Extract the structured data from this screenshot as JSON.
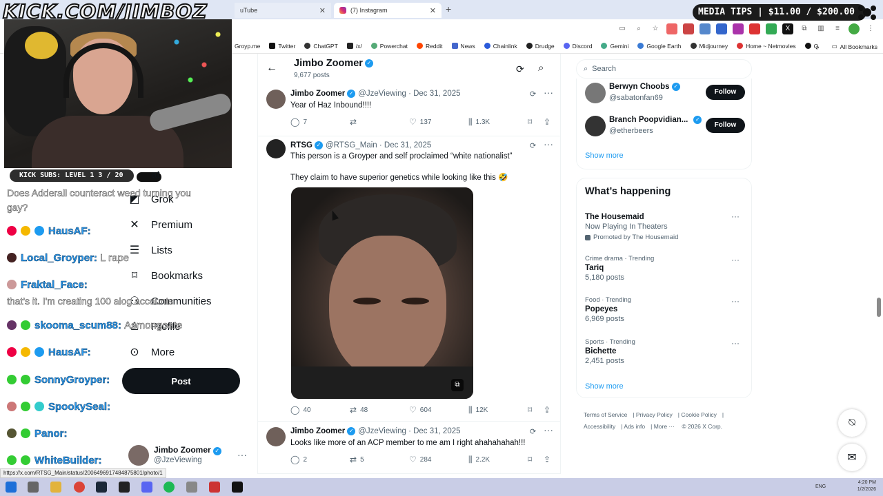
{
  "browser": {
    "tabs": [
      {
        "title": "uTube",
        "icon": "youtube-icon"
      },
      {
        "title": "(7) Instagram",
        "icon": "instagram-icon"
      }
    ],
    "bookmarks": [
      "Groyp.me",
      "Twitter",
      "ChatGPT",
      "/x/",
      "Powerchat",
      "Reddit",
      "News",
      "Chainlink",
      "Drudge",
      "Discord",
      "Gemini",
      "Google Earth",
      "Midjourney",
      "Home ~ Netmovies",
      "Q"
    ],
    "all_bookmarks": "All Bookmarks",
    "status_url": "https://x.com/RTSG_Main/status/2006496917484875801/photo/1"
  },
  "overlay": {
    "stream_title": "KICK.COM/JIMBOZ",
    "media_tips": "MEDIA TIPS | $11.00 / $200.00",
    "kick_subs": "KICK SUBS: LEVEL 1 3 / 20",
    "chat": [
      {
        "text": "Does Adderall counteract weed turning you gay?"
      },
      {
        "user": "HausAF:",
        "msg": ""
      },
      {
        "user": "Local_Groyper:",
        "msg": "L rape"
      },
      {
        "user": "Fraktal_Face:",
        "msg": ""
      },
      {
        "text": "that's it. I'm creating 100 alog accounts"
      },
      {
        "user": "skooma_scum88:",
        "msg": "Asmongoate"
      },
      {
        "user": "HausAF:",
        "msg": ""
      },
      {
        "user": "SonnyGroyper:",
        "msg": ""
      },
      {
        "user": "SpookySeal:",
        "msg": ""
      },
      {
        "user": "Panor:",
        "msg": ""
      },
      {
        "user": "WhiteBuilder:",
        "msg": ""
      }
    ]
  },
  "nav": {
    "items": [
      "at",
      "Grok",
      "Premium",
      "Lists",
      "Bookmarks",
      "Communities",
      "Profile",
      "More"
    ],
    "post_label": "Post",
    "account_name": "Jimbo Zoomer",
    "account_handle": "@JzeViewing"
  },
  "profile_header": {
    "name": "Jimbo Zoomer",
    "posts": "9,677 posts"
  },
  "tweets": [
    {
      "name": "Jimbo Zoomer",
      "handle": "@JzeViewing",
      "date": "· Dec 31, 2025",
      "text": "Year of Haz Inbound!!!!",
      "replies": "7",
      "reposts": "",
      "likes": "137",
      "views": "1.3K"
    },
    {
      "name": "RTSG",
      "handle": "@RTSG_Main",
      "date": "· Dec 31, 2025",
      "text": "This person is a Groyper and self proclaimed “white nationalist”",
      "text2": "They claim to have superior genetics while looking like this 🤣",
      "replies": "40",
      "reposts": "48",
      "likes": "604",
      "views": "12K"
    },
    {
      "name": "Jimbo Zoomer",
      "handle": "@JzeViewing",
      "date": "· Dec 31, 2025",
      "text": "Looks like more of an ACP member to me am I right ahahahahah!!!",
      "replies": "2",
      "reposts": "5",
      "likes": "284",
      "views": "2.2K"
    }
  ],
  "sidebar": {
    "search_placeholder": "Search",
    "who_to_follow": [
      {
        "name": "Berwyn Choobs",
        "handle": "@sabatonfan69",
        "button": "Follow"
      },
      {
        "name": "Branch Poopvidian...",
        "handle": "@etherbeers",
        "button": "Follow"
      }
    ],
    "show_more": "Show more",
    "whats_happening_title": "What’s happening",
    "trends": [
      {
        "meta": "",
        "name": "The Housemaid",
        "sub": "Now Playing In Theaters",
        "promo": "Promoted by The Housemaid"
      },
      {
        "meta": "Crime drama · Trending",
        "name": "Tariq",
        "sub": "5,180 posts"
      },
      {
        "meta": "Food · Trending",
        "name": "Popeyes",
        "sub": "6,969 posts"
      },
      {
        "meta": "Sports · Trending",
        "name": "Bichette",
        "sub": "2,451 posts"
      }
    ],
    "footer": [
      "Terms of Service",
      "Privacy Policy",
      "Cookie Policy",
      "Accessibility",
      "Ads info",
      "More ···",
      "© 2026 X Corp."
    ]
  },
  "taskbar": {
    "lang": "ENG",
    "time": "4:20 PM",
    "date": "1/2/2026"
  }
}
